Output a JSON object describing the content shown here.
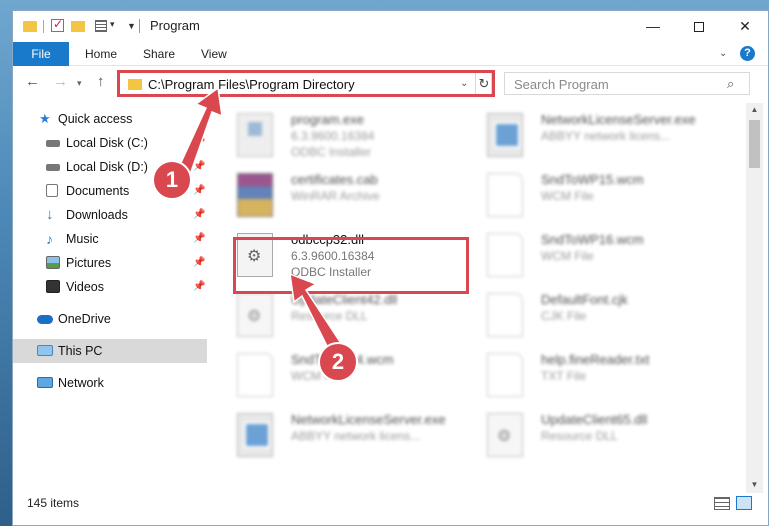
{
  "window": {
    "title": "Program"
  },
  "controls": {
    "minimize": "—",
    "maximize": "",
    "close": "✕"
  },
  "ribbon": {
    "tabs": [
      "File",
      "Home",
      "Share",
      "View"
    ],
    "help": "?"
  },
  "address": {
    "path": "C:\\Program Files\\Program Directory"
  },
  "search": {
    "placeholder": "Search Program"
  },
  "sidebar": {
    "items": [
      {
        "label": "Quick access",
        "icon": "star-icon",
        "pinned": false
      },
      {
        "label": "Local Disk (C:)",
        "icon": "drive-icon",
        "pinned": true
      },
      {
        "label": "Local Disk (D:)",
        "icon": "drive-icon",
        "pinned": true
      },
      {
        "label": "Documents",
        "icon": "documents-icon",
        "pinned": true
      },
      {
        "label": "Downloads",
        "icon": "download-icon",
        "pinned": true
      },
      {
        "label": "Music",
        "icon": "music-icon",
        "pinned": true
      },
      {
        "label": "Pictures",
        "icon": "pictures-icon",
        "pinned": true
      },
      {
        "label": "Videos",
        "icon": "videos-icon",
        "pinned": true
      },
      {
        "label": "OneDrive",
        "icon": "cloud-icon",
        "pinned": false
      },
      {
        "label": "This PC",
        "icon": "computer-icon",
        "pinned": false,
        "selected": true
      },
      {
        "label": "Network",
        "icon": "network-icon",
        "pinned": false
      }
    ],
    "pin_glyph": "📌"
  },
  "files": [
    {
      "name": "program.exe",
      "meta1": "6.3.9600.16384",
      "meta2": "ODBC Installer"
    },
    {
      "name": "NetworkLicenseServer.exe",
      "meta1": "ABBYY network licens...",
      "meta2": ""
    },
    {
      "name": "certificates.cab",
      "meta1": "WinRAR Archive",
      "meta2": ""
    },
    {
      "name": "SndToWP15.wcm",
      "meta1": "WCM File",
      "meta2": ""
    },
    {
      "name": "odbccp32.dll",
      "meta1": "6.3.9600.16384",
      "meta2": "ODBC Installer"
    },
    {
      "name": "SndToWP16.wcm",
      "meta1": "WCM File",
      "meta2": ""
    },
    {
      "name": "UpdateClient42.dll",
      "meta1": "Resource DLL",
      "meta2": ""
    },
    {
      "name": "DefaultFont.cjk",
      "meta1": "CJK File",
      "meta2": ""
    },
    {
      "name": "SndToWP14.wcm",
      "meta1": "WCM File",
      "meta2": ""
    },
    {
      "name": "help.fineReader.txt",
      "meta1": "TXT File",
      "meta2": ""
    },
    {
      "name": "NetworkLicenseServer.exe",
      "meta1": "ABBYY network licens...",
      "meta2": ""
    },
    {
      "name": "UpdateClient65.dll",
      "meta1": "Resource DLL",
      "meta2": ""
    }
  ],
  "status": {
    "count": "145 items"
  },
  "callouts": [
    "1",
    "2"
  ],
  "colors": {
    "accent": "#1979ca",
    "highlight": "#d9474f"
  }
}
